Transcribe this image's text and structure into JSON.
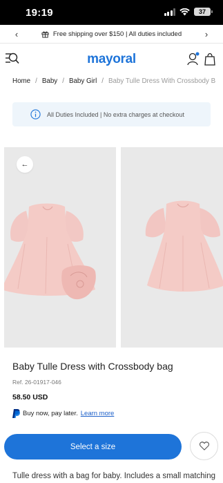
{
  "status_bar": {
    "time": "19:19",
    "battery": "37"
  },
  "promo": {
    "text": "Free shipping over $150 | All duties included",
    "prev_icon": "chevron-left-icon",
    "next_icon": "chevron-right-icon",
    "gift_icon": "gift-icon"
  },
  "header": {
    "logo": "mayoral",
    "brand_color": "#1e74d9",
    "menu_icon": "menu-search-icon",
    "account_icon": "account-icon",
    "bag_icon": "shopping-bag-icon"
  },
  "breadcrumb": {
    "items": [
      "Home",
      "Baby",
      "Baby Girl"
    ],
    "current": "Baby Tulle Dress With Crossbody B"
  },
  "notice": {
    "text": "All Duties Included | No extra charges at checkout",
    "icon": "info-icon"
  },
  "gallery": {
    "back_icon": "arrow-left-icon",
    "dress_color": "#f1c1bd"
  },
  "product": {
    "title": "Baby Tulle Dress with Crossbody bag",
    "ref": "Ref. 26-01917-046",
    "price": "58.50 USD"
  },
  "paypal": {
    "text": "Buy now, pay later.",
    "link": "Learn more",
    "icon": "paypal-icon"
  },
  "actions": {
    "select_size": "Select a size",
    "wishlist_icon": "heart-icon"
  },
  "description": "Tulle dress with a bag for baby. Includes a small matching"
}
